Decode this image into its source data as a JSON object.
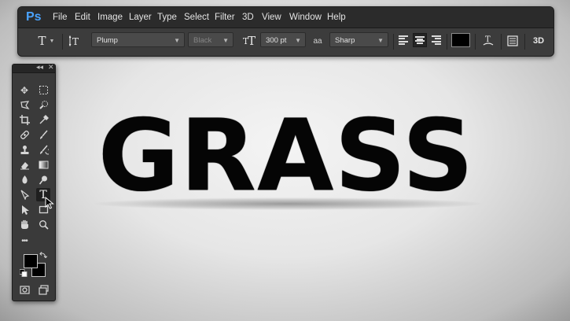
{
  "app": {
    "logo": "Ps"
  },
  "menu": [
    "File",
    "Edit",
    "Image",
    "Layer",
    "Type",
    "Select",
    "Filter",
    "3D",
    "View",
    "Window",
    "Help"
  ],
  "options": {
    "font_family": "Plump",
    "font_style": "Black",
    "font_size": "300 pt",
    "anti_alias_icon": "aa",
    "anti_alias": "Sharp",
    "text_color": "#000000",
    "mode_3d": "3D"
  },
  "toolbox": {
    "collapse": "◂◂",
    "close": "✕",
    "more": "•••"
  },
  "canvas": {
    "text": "GRASS",
    "text_color": "#000000"
  }
}
